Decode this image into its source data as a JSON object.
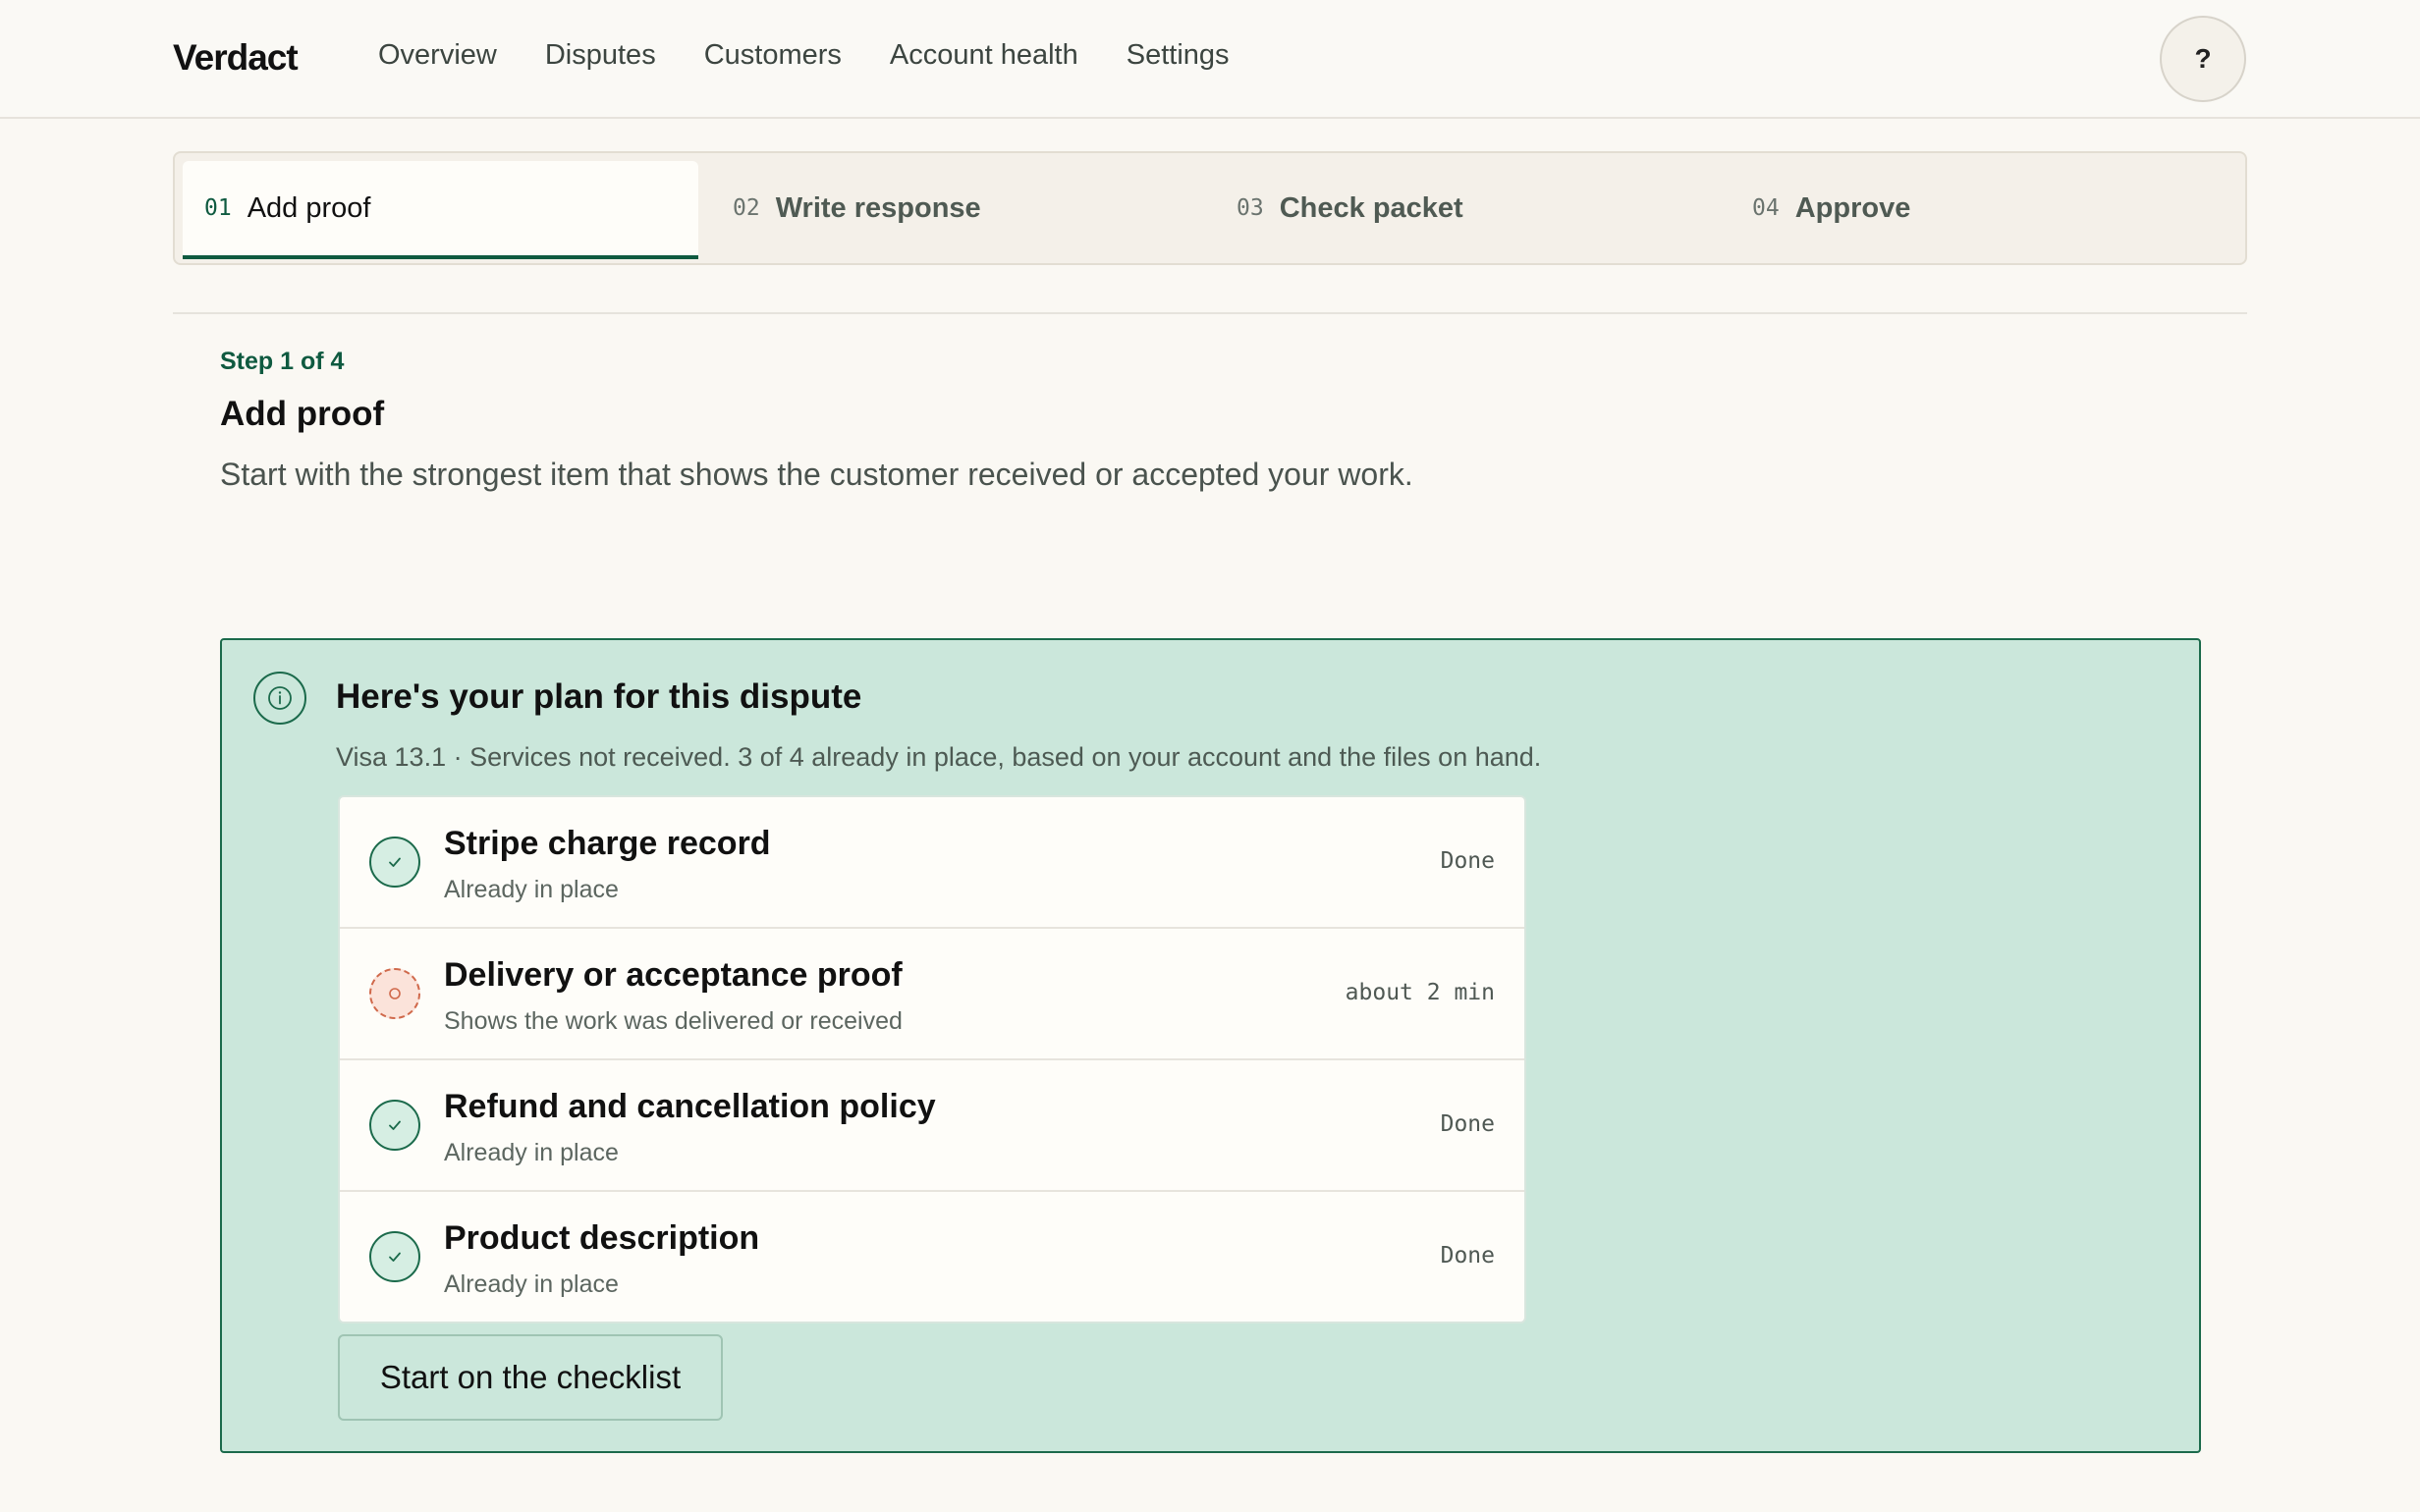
{
  "app": {
    "brand": "Verdact"
  },
  "nav": {
    "items": [
      {
        "label": "Overview"
      },
      {
        "label": "Disputes"
      },
      {
        "label": "Customers"
      },
      {
        "label": "Account health"
      },
      {
        "label": "Settings"
      }
    ],
    "help_label": "?"
  },
  "stepper": {
    "steps": [
      {
        "num": "01",
        "label": "Add proof",
        "active": true
      },
      {
        "num": "02",
        "label": "Write response",
        "active": false
      },
      {
        "num": "03",
        "label": "Check packet",
        "active": false
      },
      {
        "num": "04",
        "label": "Approve",
        "active": false
      }
    ]
  },
  "intro": {
    "eyebrow": "Step 1 of 4",
    "title": "Add proof",
    "description": "Start with the strongest item that shows the customer received or accepted your work."
  },
  "plan": {
    "icon": "info-icon",
    "title": "Here's your plan for this dispute",
    "subtitle": "Visa 13.1 · Services not received. 3 of 4 already in place, based on your account and the files on hand.",
    "items": [
      {
        "title": "Stripe charge record",
        "sub": "Already in place",
        "meta": "Done",
        "status": "done"
      },
      {
        "title": "Delivery or acceptance proof",
        "sub": "Shows the work was delivered or received",
        "meta": "about 2 min",
        "status": "pending"
      },
      {
        "title": "Refund and cancellation policy",
        "sub": "Already in place",
        "meta": "Done",
        "status": "done"
      },
      {
        "title": "Product description",
        "sub": "Already in place",
        "meta": "Done",
        "status": "done"
      }
    ],
    "cta_label": "Start on the checklist"
  },
  "colors": {
    "accent": "#0f5a40",
    "plan_bg": "#cbe7db",
    "pending": "#d0694b"
  }
}
